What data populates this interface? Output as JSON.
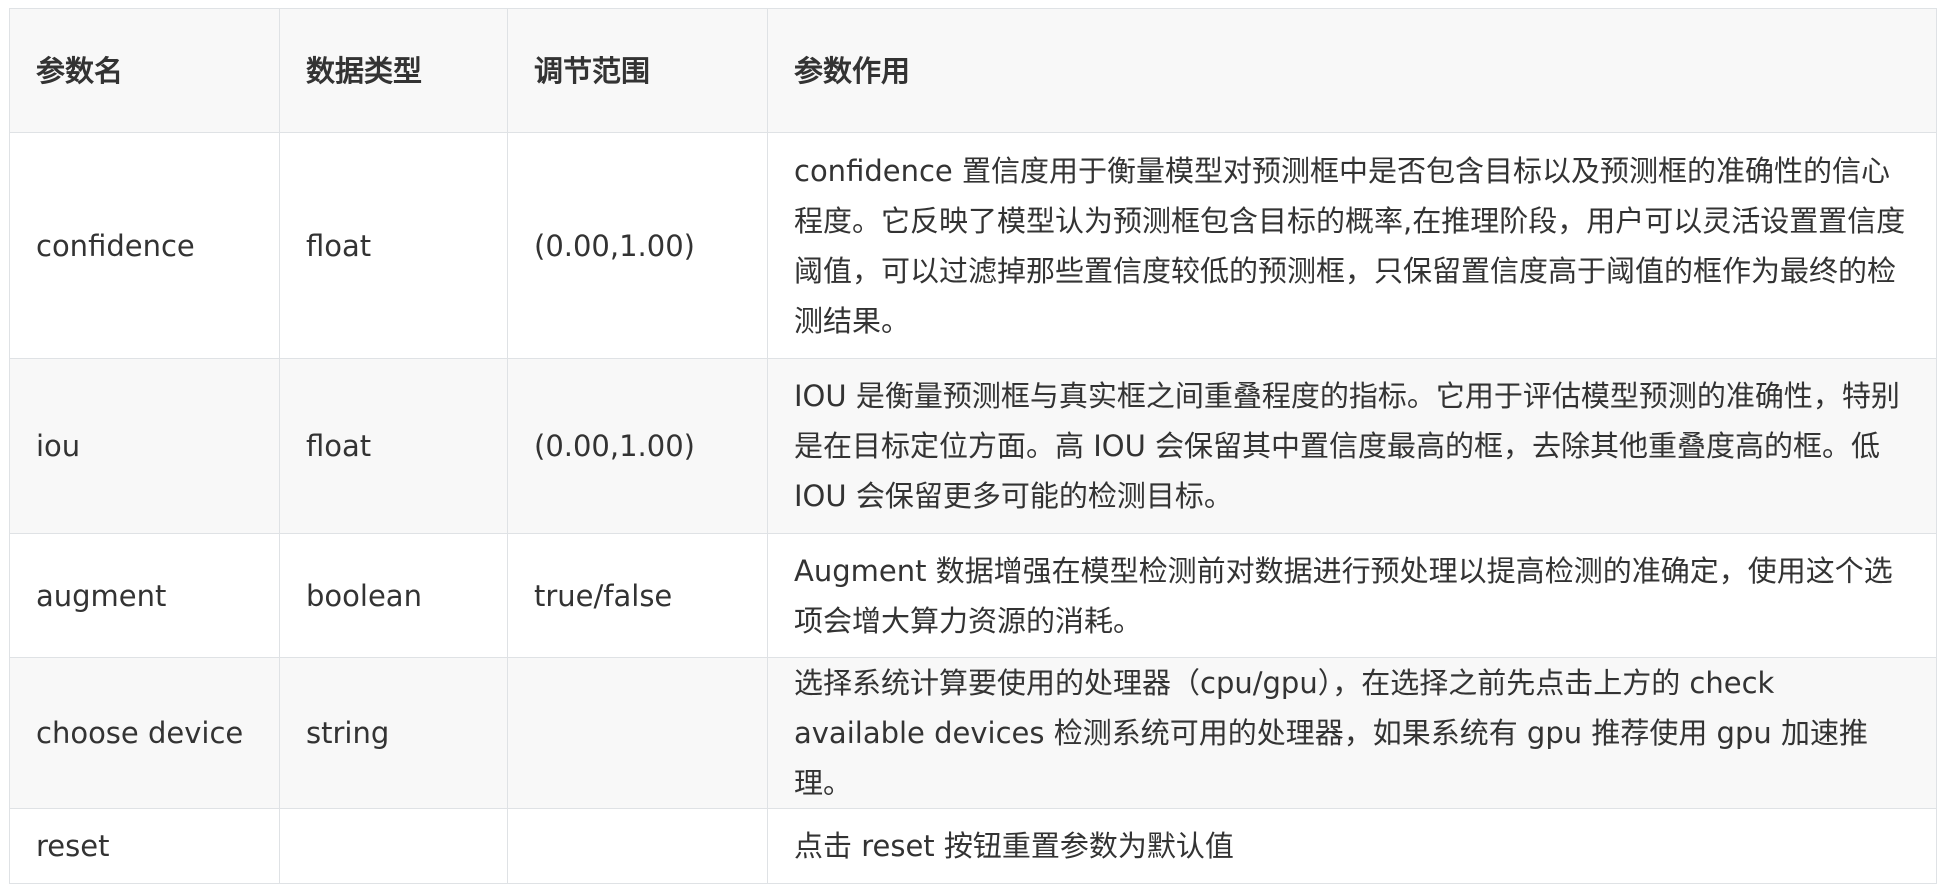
{
  "table": {
    "headers": {
      "name": "参数名",
      "type": "数据类型",
      "range": "调节范围",
      "description": "参数作用"
    },
    "rows": [
      {
        "name": "confidence",
        "type": "float",
        "range": "(0.00,1.00)",
        "description": "confidence 置信度用于衡量模型对预测框中是否包含目标以及预测框的准确性的信心程度。它反映了模型认为预测框包含目标的概率,在推理阶段，用户可以灵活设置置信度阈值，可以过滤掉那些置信度较低的预测框，只保留置信度高于阈值的框作为最终的检测结果。"
      },
      {
        "name": "iou",
        "type": "float",
        "range": "(0.00,1.00)",
        "description": "IOU 是衡量预测框与真实框之间重叠程度的指标。它用于评估模型预测的准确性，特别是在目标定位方面。高 IOU 会保留其中置信度最高的框，去除其他重叠度高的框。低 IOU 会保留更多可能的检测目标。"
      },
      {
        "name": "augment",
        "type": "boolean",
        "range": "true/false",
        "description": "Augment 数据增强在模型检测前对数据进行预处理以提高检测的准确定，使用这个选项会增大算力资源的消耗。"
      },
      {
        "name": "choose device",
        "type": "string",
        "range": "",
        "description": "选择系统计算要使用的处理器（cpu/gpu），在选择之前先点击上方的 check available devices 检测系统可用的处理器，如果系统有 gpu 推荐使用 gpu 加速推理。"
      },
      {
        "name": "reset",
        "type": "",
        "range": "",
        "description": "点击 reset 按钮重置参数为默认值"
      }
    ]
  }
}
